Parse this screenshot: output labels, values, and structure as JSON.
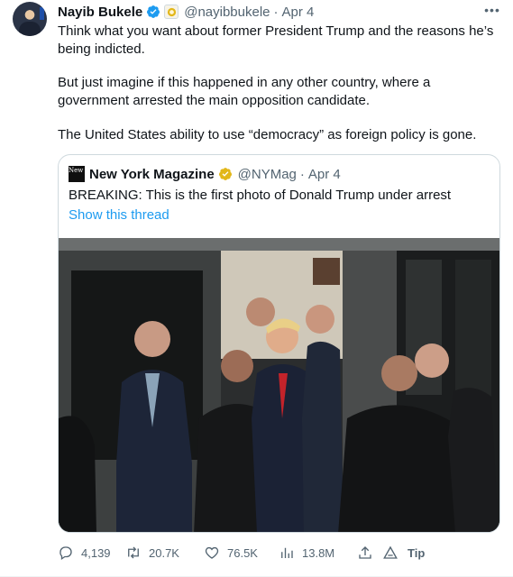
{
  "tweet": {
    "author": {
      "name": "Nayib Bukele",
      "handle": "@nayibbukele",
      "date": "Apr 4",
      "dot": "·"
    },
    "more_label": "•••",
    "paragraphs": [
      "Think what you want about former President Trump and the reasons he’s being indicted.",
      "But just imagine if this happened in any other country, where a government arrested the main opposition candidate.",
      "The United States ability to use “democracy” as foreign policy is gone."
    ],
    "quote": {
      "logo_text": "New York",
      "name": "New York Magazine",
      "handle": "@NYMag",
      "dot": "·",
      "date": "Apr 4",
      "text": "BREAKING: This is the first photo of Donald Trump under arrest",
      "thread_link": "Show this thread"
    },
    "actions": {
      "replies": "4,139",
      "retweets": "20.7K",
      "likes": "76.5K",
      "views": "13.8M",
      "tip": "Tip"
    },
    "icons": {
      "verified": "verified-blue-check-icon",
      "affiliate": "affiliate-badge-icon",
      "gold_check": "verified-gold-check-icon",
      "reply": "reply-bubble-icon",
      "retweet": "retweet-arrows-icon",
      "like": "heart-icon",
      "views": "views-bar-chart-icon",
      "share": "share-upload-icon",
      "tip": "tip-icon"
    },
    "colors": {
      "accent": "#1d9bf0",
      "gold": "#e2b719",
      "muted": "#536471",
      "text": "#0f1419"
    }
  }
}
